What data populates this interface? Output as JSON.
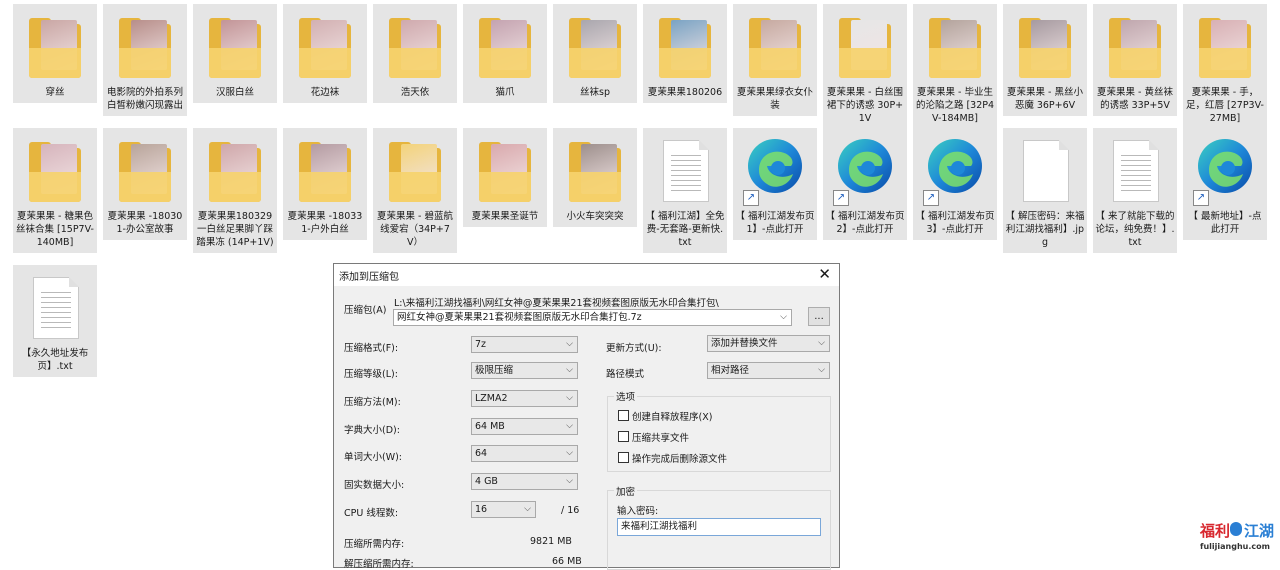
{
  "files": [
    {
      "label": "穿丝",
      "type": "folder",
      "color": "#c9a6a4"
    },
    {
      "label": "电影院的外拍系列白皙粉嫩闪现露出",
      "type": "folder",
      "color": "#b78e8a"
    },
    {
      "label": "汉服白丝",
      "type": "folder",
      "color": "#c29497"
    },
    {
      "label": "花边袜",
      "type": "folder",
      "color": "#d2b0b2"
    },
    {
      "label": "浩天依",
      "type": "folder",
      "color": "#cfa9ad"
    },
    {
      "label": "猫爪",
      "type": "folder",
      "color": "#c4a3b0"
    },
    {
      "label": "丝袜sp",
      "type": "folder",
      "color": "#a9a6ad"
    },
    {
      "label": "夏茉果果180206",
      "type": "folder",
      "color": "#7aa3c4"
    },
    {
      "label": "夏茉果果绿衣女仆装",
      "type": "folder",
      "color": "#c6a9a0"
    },
    {
      "label": "夏茉果果 - 白丝围裙下的诱惑 30P+1V",
      "type": "folder",
      "color": "#e6e6e6"
    },
    {
      "label": "夏茉果果 - 毕业生的沦陷之路 [32P4V-184MB]",
      "type": "folder",
      "color": "#b3a39c"
    },
    {
      "label": "夏茉果果 - 黑丝小恶魔 36P+6V",
      "type": "folder",
      "color": "#a69aa0"
    },
    {
      "label": "夏茉果果 - 黄丝袜的诱惑 33P+5V",
      "type": "folder",
      "color": "#bfa6ad"
    },
    {
      "label": "夏茉果果 - 手，足，红唇 [27P3V-27MB]",
      "type": "folder",
      "color": "#d8b0b4"
    },
    {
      "label": "夏茉果果 - 糖果色丝袜合集 [15P7V-140MB]",
      "type": "folder",
      "color": "#d6b4bc"
    },
    {
      "label": "夏茉果果 -180301-办公室故事",
      "type": "folder",
      "color": "#b8a49a"
    },
    {
      "label": "夏茉果果180329一白丝足果脚丫踩踏果冻 (14P+1V)",
      "type": "folder",
      "color": "#cfa7aa"
    },
    {
      "label": "夏茉果果 -180331-户外白丝",
      "type": "folder",
      "color": "#b49ba2"
    },
    {
      "label": "夏茉果果 - 碧蓝航线爱宕（34P+7V）",
      "type": "folder",
      "color": "#f3d37a"
    },
    {
      "label": "夏茉果果圣诞节",
      "type": "folder",
      "color": "#d9a9ad"
    },
    {
      "label": "小火车突突突",
      "type": "folder",
      "color": "#9d8f8c"
    },
    {
      "label": "【 福利江湖】全免费-无套路-更新快.txt",
      "type": "txt"
    },
    {
      "label": "【 福利江湖发布页1】-点此打开",
      "type": "edge"
    },
    {
      "label": "【 福利江湖发布页2】-点此打开",
      "type": "edge"
    },
    {
      "label": "【 福利江湖发布页3】-点此打开",
      "type": "edge"
    },
    {
      "label": "【 解压密码：来福利江湖找福利】.jpg",
      "type": "blank"
    },
    {
      "label": "【 来了就能下载的论坛，纯免费！】.txt",
      "type": "txt"
    },
    {
      "label": "【 最新地址】-点此打开",
      "type": "edge"
    },
    {
      "label": "【永久地址发布页】.txt",
      "type": "txt"
    }
  ],
  "dialog": {
    "title": "添加到压缩包",
    "close": "✕",
    "archive_label": "压缩包(A)",
    "archive_path": "L:\\来福利江湖找福利\\网红女神@夏茉果果21套视频套图原版无水印合集打包\\",
    "archive_name": "网红女神@夏茉果果21套视频套图原版无水印合集打包.7z",
    "browse": "...",
    "rows": [
      {
        "label": "压缩格式(F):",
        "value": "7z"
      },
      {
        "label": "压缩等级(L):",
        "value": "极限压缩"
      },
      {
        "label": "压缩方法(M):",
        "value": "LZMA2"
      },
      {
        "label": "字典大小(D):",
        "value": "64 MB"
      },
      {
        "label": "单词大小(W):",
        "value": "64"
      },
      {
        "label": "固实数据大小:",
        "value": "4 GB"
      }
    ],
    "cpu_label": "CPU 线程数:",
    "cpu_value": "16",
    "cpu_total": "/ 16",
    "mem_label": "压缩所需内存:",
    "mem_value": "9821 MB",
    "mem2_label": "解压缩所需内存:",
    "mem2_value": "66 MB",
    "update_label": "更新方式(U):",
    "update_value": "添加并替换文件",
    "path_label": "路径模式",
    "path_value": "相对路径",
    "options_title": "选项",
    "opt1": "创建自释放程序(X)",
    "opt2": "压缩共享文件",
    "opt3": "操作完成后删除源文件",
    "encrypt_title": "加密",
    "pw_label": "输入密码:",
    "pw_value": "来福利江湖找福利"
  },
  "watermark": {
    "brand": "福利",
    "brand2": "江湖",
    "url": "fulijianghu.com"
  }
}
